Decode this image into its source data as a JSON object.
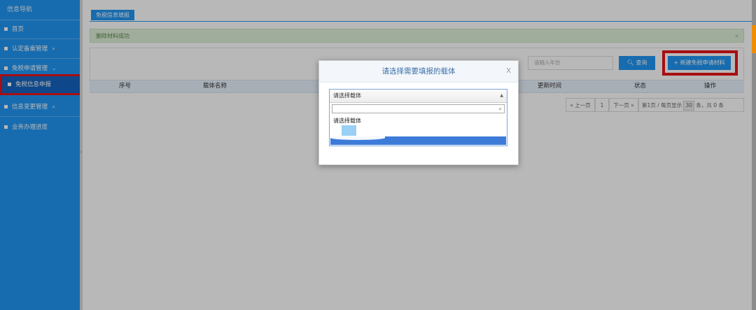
{
  "sidebar": {
    "title": "信息导航",
    "items": [
      {
        "label": "首页"
      },
      {
        "label": "认定备案管理",
        "chevron": "»"
      },
      {
        "label": "免税申请管理",
        "chevron": "⌄"
      },
      {
        "label": "免税信息申报"
      },
      {
        "label": "信息变更管理",
        "chevron": "»"
      },
      {
        "label": "业务办理进度"
      }
    ]
  },
  "tab": {
    "label": "免税信息填报"
  },
  "alert": {
    "message": "删除材料成功",
    "close": "×"
  },
  "toolbar": {
    "search_placeholder": "请输入年份",
    "query_label": "查询",
    "new_label": "新建免税申请材料"
  },
  "table": {
    "columns": [
      "序号",
      "载体名称",
      "更新时间",
      "状态",
      "操作"
    ]
  },
  "pager": {
    "prev": "« 上一页",
    "page": "1",
    "next": "下一页 »",
    "info_prefix": "第1页 / 每页显示",
    "page_size": "30",
    "info_suffix": "条，共 0 条"
  },
  "modal": {
    "title": "请选择需要填报的载体",
    "close": "X",
    "select_value": "请选择载体",
    "option_label": "请选择载体"
  },
  "icons": {
    "search": "search-icon",
    "plus": "plus-icon",
    "doc": "doc-icon"
  },
  "colors": {
    "primary": "#2196f3",
    "highlight_border": "#e8141a",
    "alert_bg": "#dff0d8"
  }
}
